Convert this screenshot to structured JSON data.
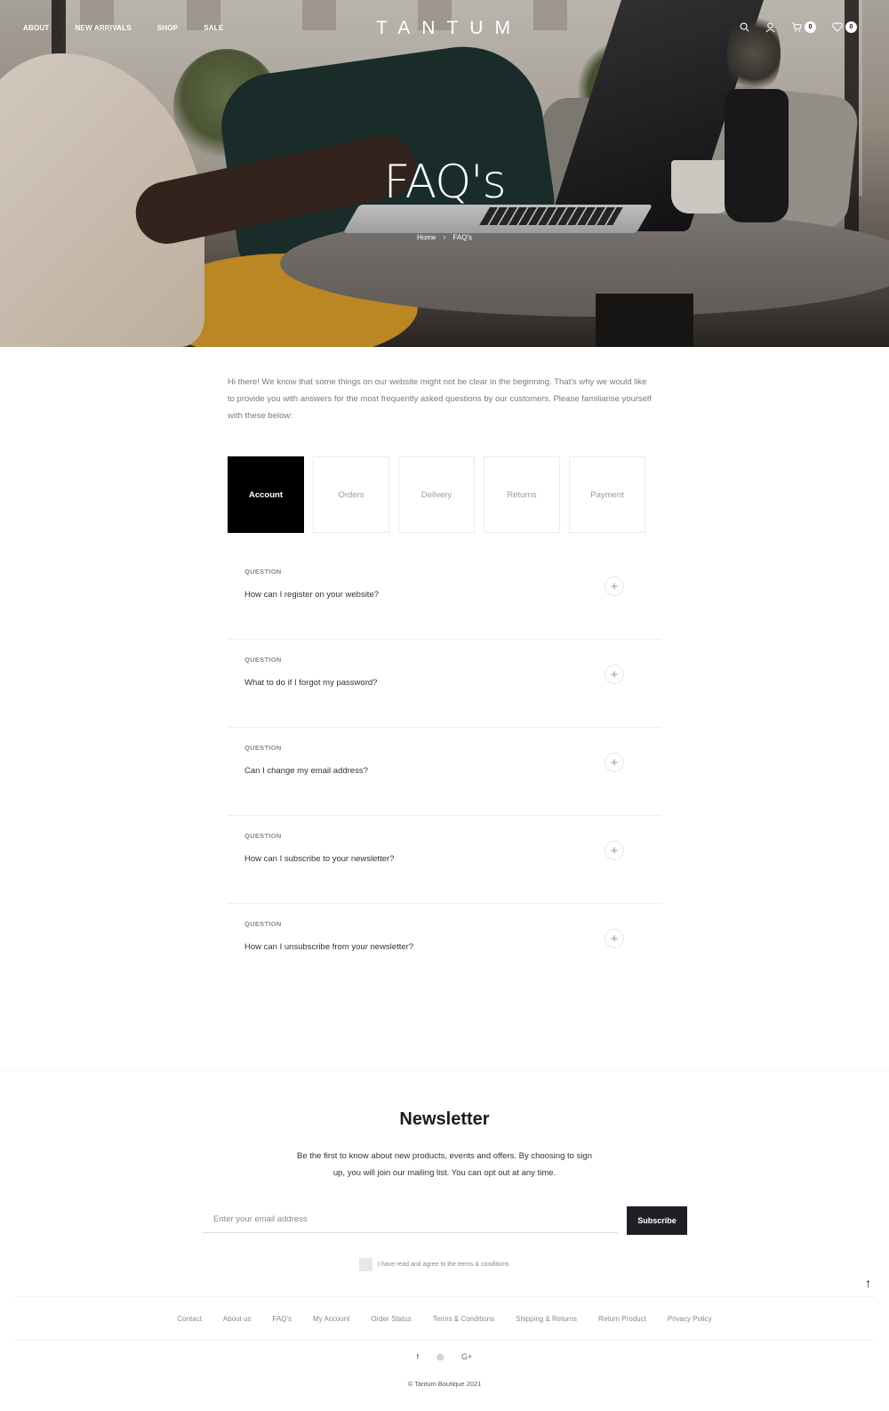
{
  "nav": {
    "links": [
      "ABOUT",
      "NEW ARRIVALS",
      "SHOP",
      "SALE"
    ],
    "brand": "TANTUM",
    "cart_count": "0",
    "wishlist_count": "0"
  },
  "hero": {
    "title": "FAQ's",
    "breadcrumb": [
      "Home",
      "FAQ's"
    ]
  },
  "intro": "Hi there! We know that some things on our website might not be clear in the beginning. That's why we would like to provide you with answers for the most frequently asked questions by our customers. Please familiarise yourself with these below:",
  "tabs": [
    "Account",
    "Orders",
    "Delivery",
    "Returns",
    "Payment"
  ],
  "active_tab": "Account",
  "faq": [
    {
      "label": "QUESTION",
      "question": "How can I register on your website?"
    },
    {
      "label": "QUESTION",
      "question": "What to do if I forgot my password?"
    },
    {
      "label": "QUESTION",
      "question": "Can I change my email address?"
    },
    {
      "label": "QUESTION",
      "question": "How can I subscribe to your newsletter?"
    },
    {
      "label": "QUESTION",
      "question": "How can I unsubscribe from your newsletter?"
    }
  ],
  "newsletter": {
    "title": "Newsletter",
    "text": "Be the first to know about new products, events and offers. By choosing to sign up, you will join our mailing list. You can opt out at any time.",
    "placeholder": "Enter your email address",
    "button": "Subscribe",
    "agree": "I have read and agree to the terms & conditions"
  },
  "footer": {
    "links": [
      "Contact",
      "About us",
      "FAQ's",
      "My Account",
      "Order Status",
      "Terms & Conditions",
      "Shipping & Returns",
      "Return Product",
      "Privacy Policy"
    ],
    "social": [
      "f",
      "◎",
      "G+"
    ],
    "copyright": "© Tantum Boutique 2021"
  },
  "icons": {
    "search": "search-icon",
    "account": "user-icon",
    "cart": "cart-icon",
    "wishlist": "heart-icon",
    "plus": "plus-icon",
    "top": "arrow-up-icon"
  },
  "colors": {
    "active_tab_bg": "#000000",
    "button_bg": "#1e1e24"
  }
}
